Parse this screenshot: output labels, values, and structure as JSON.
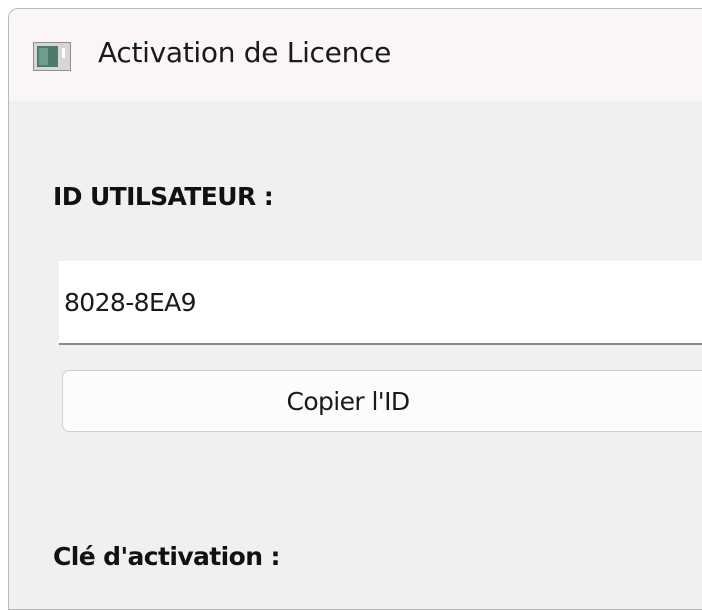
{
  "window": {
    "title": "Activation de Licence",
    "icon": "app-window-icon"
  },
  "user_id_section": {
    "label": "ID UTILSATEUR :",
    "value": "8028-8EA9",
    "copy_button_label": "Copier l'ID"
  },
  "activation_key_section": {
    "label": "Clé d'activation :"
  },
  "colors": {
    "window_background": "#f0f0f0",
    "titlebar_background": "#fbf6f6",
    "field_background": "#ffffff",
    "button_background": "#fcfcfc"
  }
}
